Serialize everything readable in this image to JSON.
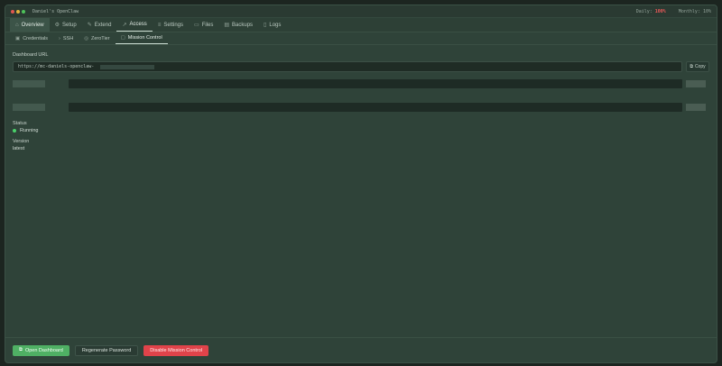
{
  "window": {
    "title": "Daniel's OpenClaw",
    "usage": {
      "daily_label": "Daily:",
      "daily_value": "100%",
      "monthly_label": "Monthly:",
      "monthly_value": "10%"
    }
  },
  "tabs": [
    {
      "label": "Overview",
      "icon": "home-icon"
    },
    {
      "label": "Setup",
      "icon": "gear-icon"
    },
    {
      "label": "Extend",
      "icon": "pen-icon"
    },
    {
      "label": "Access",
      "icon": "chart-icon"
    },
    {
      "label": "Settings",
      "icon": "sliders-icon"
    },
    {
      "label": "Files",
      "icon": "folder-icon"
    },
    {
      "label": "Backups",
      "icon": "backup-icon"
    },
    {
      "label": "Logs",
      "icon": "document-icon"
    }
  ],
  "subtabs": [
    {
      "label": "Credentials",
      "icon": "key-icon"
    },
    {
      "label": "SSH",
      "icon": "terminal-icon"
    },
    {
      "label": "ZeroTier",
      "icon": "network-icon"
    },
    {
      "label": "Mission Control",
      "icon": "dashboard-icon"
    }
  ],
  "dashboard": {
    "url_label": "Dashboard URL",
    "url_value": "https://mc-daniels-openclaw-",
    "copy_label": "Copy"
  },
  "status": {
    "label": "Status",
    "value": "Running",
    "color": "#4ad06a"
  },
  "version": {
    "label": "Version",
    "value": "latest"
  },
  "footer": {
    "open_label": "Open Dashboard",
    "regenerate_label": "Regenerate Password",
    "disable_label": "Disable Mission Control"
  },
  "colors": {
    "primary": "#4fb064",
    "danger": "#e0434a",
    "background": "#2f4339"
  }
}
